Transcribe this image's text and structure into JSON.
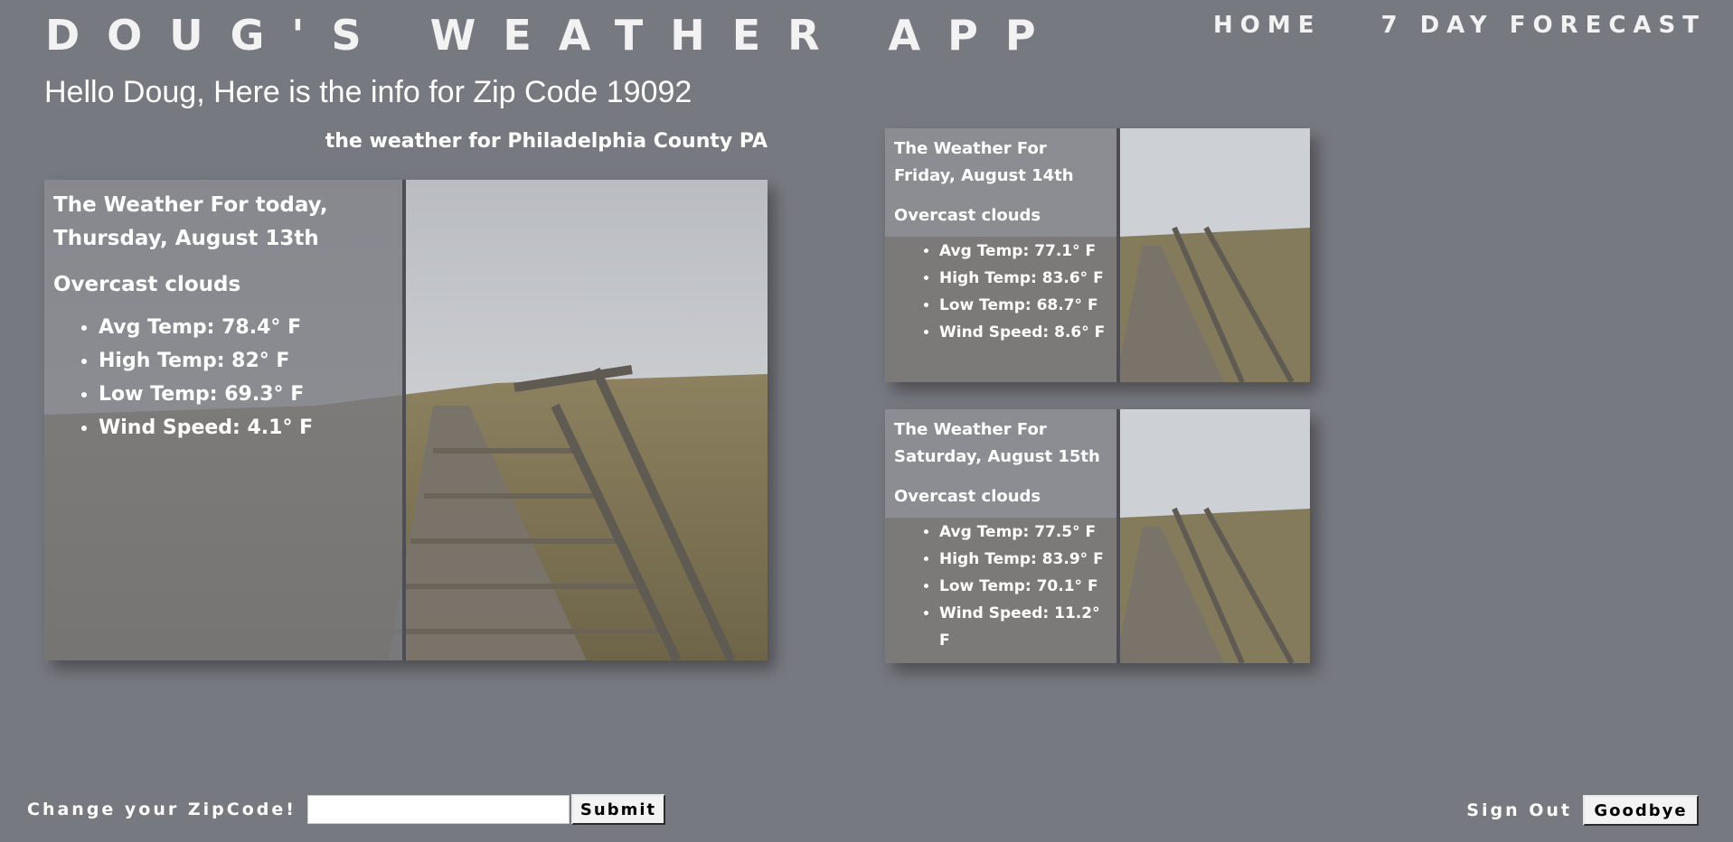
{
  "app_title": "DOUG'S WEATHER APP",
  "nav": {
    "home": "HOME",
    "forecast": "7 DAY FORECAST"
  },
  "greeting": "Hello Doug, Here is the info for Zip Code 19092",
  "location": "the weather for Philadelphia County PA",
  "today": {
    "title": "The Weather For today, Thursday, August 13th",
    "description": "Overcast clouds",
    "stats": [
      "Avg Temp: 78.4° F",
      "High Temp: 82° F",
      "Low Temp: 69.3° F",
      "Wind Speed: 4.1° F"
    ]
  },
  "forecast": [
    {
      "title": "The Weather For Friday, August 14th",
      "description": "Overcast clouds",
      "stats": [
        "Avg Temp: 77.1° F",
        "High Temp: 83.6° F",
        "Low Temp: 68.7° F",
        "Wind Speed: 8.6° F"
      ]
    },
    {
      "title": "The Weather For Saturday, August 15th",
      "description": "Overcast clouds",
      "stats": [
        "Avg Temp: 77.5° F",
        "High Temp: 83.9° F",
        "Low Temp: 70.1° F",
        "Wind Speed: 11.2° F"
      ]
    }
  ],
  "zip_form": {
    "label": "Change your ZipCode!",
    "input_value": "",
    "submit_label": "Submit"
  },
  "signout": {
    "label": "Sign Out",
    "button_label": "Goodbye"
  },
  "colors": {
    "background": "#777980",
    "text": "#ffffff",
    "card_overlay": "#787a80"
  },
  "icons": {
    "card_photo": "boardwalk-dunes-photo"
  }
}
